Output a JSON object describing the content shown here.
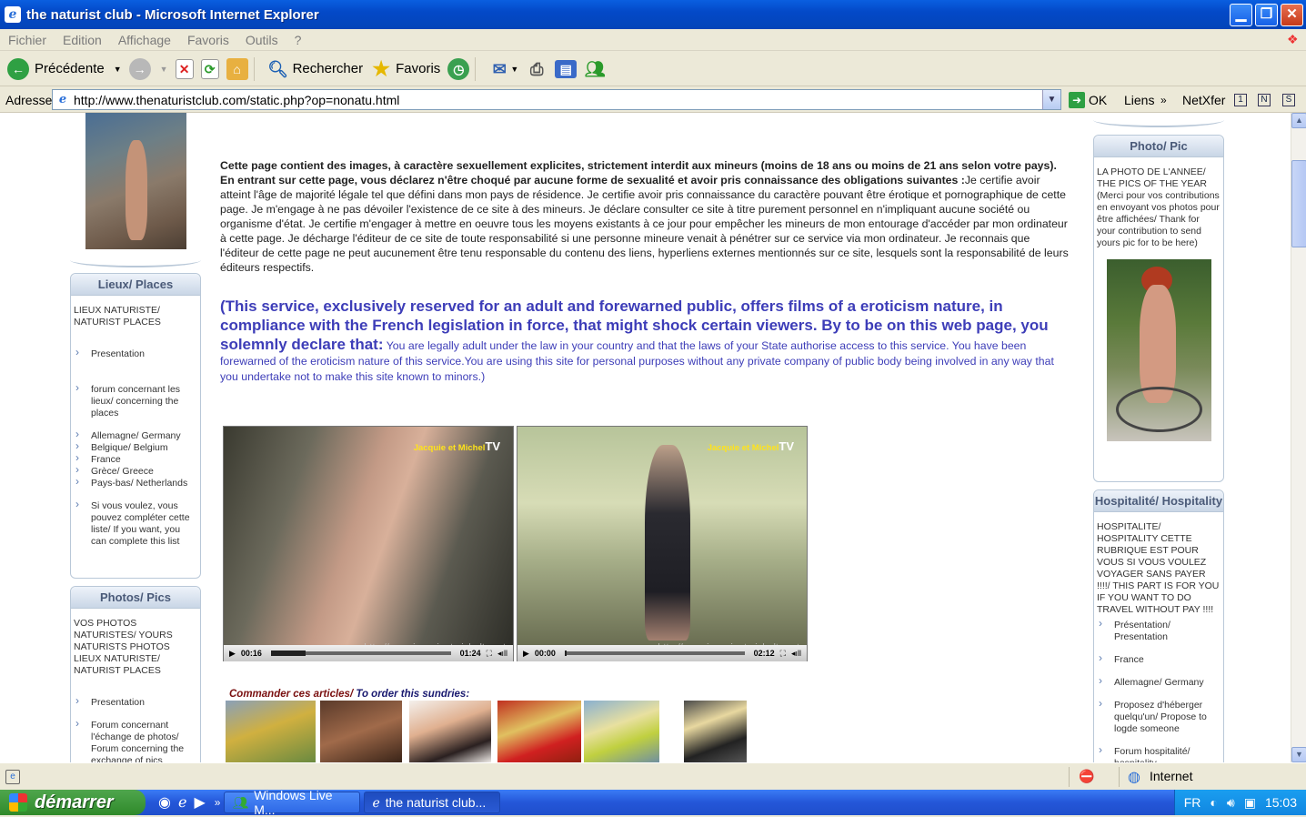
{
  "window": {
    "title": "the naturist club - Microsoft Internet Explorer",
    "minimize": "▁",
    "restore": "❐",
    "close": "✕"
  },
  "menu": [
    "Fichier",
    "Edition",
    "Affichage",
    "Favoris",
    "Outils",
    "?"
  ],
  "toolbar": {
    "back": "Précédente",
    "search": "Rechercher",
    "favorites": "Favoris"
  },
  "address": {
    "label": "Adresse",
    "url": "http://www.thenaturistclub.com/static.php?op=nonatu.html",
    "go": "OK",
    "links": "Liens",
    "netxfer": "NetXfer"
  },
  "left": {
    "places": {
      "title": "Lieux/ Places",
      "intro": "LIEUX NATURISTE/ NATURIST PLACES",
      "items": [
        "Presentation",
        "forum concernant les lieux/ concerning the places",
        "Allemagne/ Germany",
        "Belgique/ Belgium",
        "France",
        "Grèce/ Greece",
        "Pays-bas/ Netherlands",
        "Si vous voulez, vous pouvez compléter cette liste/ If you want, you can complete this list"
      ]
    },
    "photos": {
      "title": "Photos/ Pics",
      "intro": "VOS PHOTOS NATURISTES/ YOURS NATURISTS PHOTOS LIEUX NATURISTE/ NATURIST PLACES",
      "items": [
        "Presentation",
        "Forum concernant l'échange de photos/ Forum concerning the exchange of pics"
      ]
    }
  },
  "main": {
    "french_bold": "Cette page contient des images, à caractère sexuellement explicites, strictement interdit aux mineurs (moins de 18 ans ou moins de 21 ans selon votre pays). En entrant sur cette page, vous déclarez n'être choqué par aucune forme de sexualité et avoir pris connaissance des obligations suivantes :",
    "french_text": "Je certifie avoir atteint l'âge de majorité légale tel que défini dans mon pays de résidence. Je certifie avoir pris connaissance du caractère pouvant être érotique et pornographique de cette page. Je m'engage à ne pas dévoiler l'existence de ce site à des mineurs. Je déclare consulter ce site à titre purement personnel en n'impliquant aucune société ou organisme d'état. Je certifie m'engager à mettre en oeuvre tous les moyens existants à ce jour pour empêcher les mineurs de mon entourage d'accéder par mon ordinateur à cette page. Je décharge l'éditeur de ce site de toute responsabilité si une personne mineure venait à pénétrer sur ce service via mon ordinateur. Je reconnais que l'éditeur de cette page ne peut aucunement être tenu responsable du contenu des liens, hyperliens externes mentionnés sur ce site, lesquels sont la responsabilité de leurs éditeurs respectifs.",
    "english_bold": "(This service, exclusively reserved for an adult and forewarned public, offers films of a eroticism nature, in compliance with the French legislation in force, that might shock certain viewers. By to be on this web page, you solemnly declare that:",
    "english_text": " You are legally adult under the law in your country and that the laws of your State authorise access to this service. You have been forewarned of the eroticism nature of this service.You are using this site for personal purposes without any private company of public body being involved in any way that you undertake not to make this site known to minors.)",
    "videos": [
      {
        "brand": "Jacquie et Michel",
        "brand_tv": "TV",
        "url": "http://www.jacquieetmicheltv.net",
        "elapsed": "00:16",
        "total": "01:24",
        "progress": 0.19
      },
      {
        "brand": "Jacquie et Michel",
        "brand_tv": "TV",
        "url": "http://www.jacquieetmicheltv.net",
        "elapsed": "00:00",
        "total": "02:12",
        "progress": 0.01
      }
    ],
    "order_fr": "Commander ces articles/",
    "order_en": " To order this sundries:"
  },
  "right": {
    "photo": {
      "title": "Photo/ Pic",
      "text": "LA PHOTO DE L'ANNEE/ THE PICS OF THE YEAR (Merci pour vos contributions en envoyant vos photos pour être affichées/ Thank for your contribution to send yours pic for to be here)"
    },
    "hosp": {
      "title": "Hospitalité/ Hospitality",
      "intro": "HOSPITALITE/ HOSPITALITY CETTE RUBRIQUE EST POUR VOUS SI VOUS VOULEZ VOYAGER SANS PAYER !!!!/ THIS PART IS FOR YOU IF YOU WANT TO DO TRAVEL WITHOUT PAY !!!!",
      "items": [
        "Présentation/ Presentation",
        "France",
        "Allemagne/ Germany",
        "Proposez d'héberger quelqu'un/ Propose to logde someone",
        "Forum hospitalité/ hospitality"
      ]
    }
  },
  "status": {
    "zone": "Internet"
  },
  "taskbar": {
    "start": "démarrer",
    "tasks": [
      "Windows Live M...",
      "the naturist club..."
    ],
    "lang": "FR",
    "clock": "15:03"
  }
}
